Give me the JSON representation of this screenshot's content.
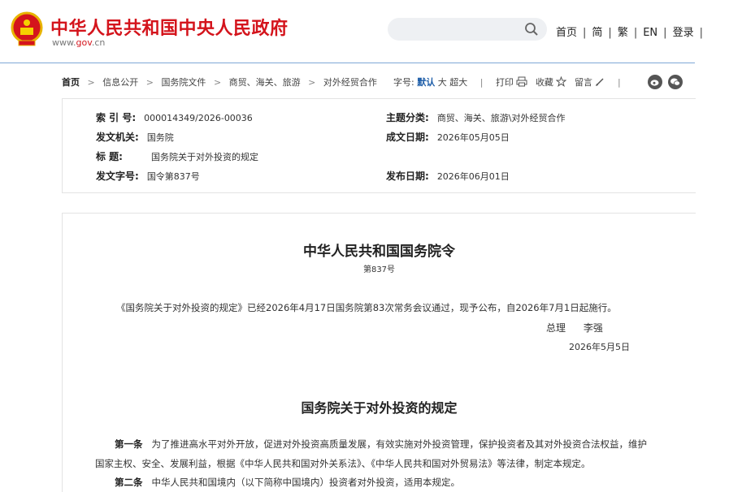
{
  "header": {
    "site_title": "中华人民共和国中央人民政府",
    "site_url_prefix": "www.",
    "site_url_gov": "gov",
    "site_url_suffix": ".cn",
    "search_placeholder": "",
    "nav": [
      "首页",
      "简",
      "繁",
      "EN",
      "登录"
    ],
    "nav_sep": "|",
    "accent_color": "#d4141c"
  },
  "breadcrumb": {
    "home": "首页",
    "arrow": ">",
    "items": [
      "信息公开",
      "国务院文件",
      "商贸、海关、旅游",
      "对外经贸合作"
    ]
  },
  "tools": {
    "font_size_label": "字号:",
    "size_default": "默认",
    "size_large": "大",
    "size_xlarge": "超大",
    "bar": "|",
    "print": "打印",
    "favorite": "收藏",
    "comment": "留言",
    "icons": [
      "print-icon",
      "star-icon",
      "pencil-icon",
      "weibo-icon",
      "wechat-icon"
    ]
  },
  "info": {
    "index_label": "索 引 号:",
    "index_value": "000014349/2026-00036",
    "category_label": "主题分类:",
    "category_value": "商贸、海关、旅游\\对外经贸合作",
    "issuer_label": "发文机关:",
    "issuer_value": "国务院",
    "created_label": "成文日期:",
    "created_value": "2026年05月05日",
    "title_label": "标 题:",
    "title_value": "国务院关于对外投资的规定",
    "docno_label": "发文字号:",
    "docno_value": "国令第837号",
    "published_label": "发布日期:",
    "published_value": "2026年06月01日"
  },
  "article": {
    "order_title": "中华人民共和国国务院令",
    "order_number": "第837号",
    "announcement": "《国务院关于对外投资的规定》已经2026年4月17日国务院第83次常务会议通过，现予公布，自2026年7月1日起施行。",
    "signer_role": "总理",
    "signer_name": "李强",
    "sign_date": "2026年5月5日",
    "regulation_title": "国务院关于对外投资的规定",
    "article1_label": "第一条",
    "article1_line1": "为了推进高水平对外开放，促进对外投资高质量发展，有效实施对外投资管理，保护投资者及其对外投资合法权益，维护",
    "article1_line2": "国家主权、安全、发展利益，根据《中华人民共和国对外关系法》、《中华人民共和国对外贸易法》等法律，制定本规定。",
    "article2_label": "第二条",
    "article2_text": "中华人民共和国境内（以下简称中国境内）投资者对外投资，适用本规定。"
  }
}
